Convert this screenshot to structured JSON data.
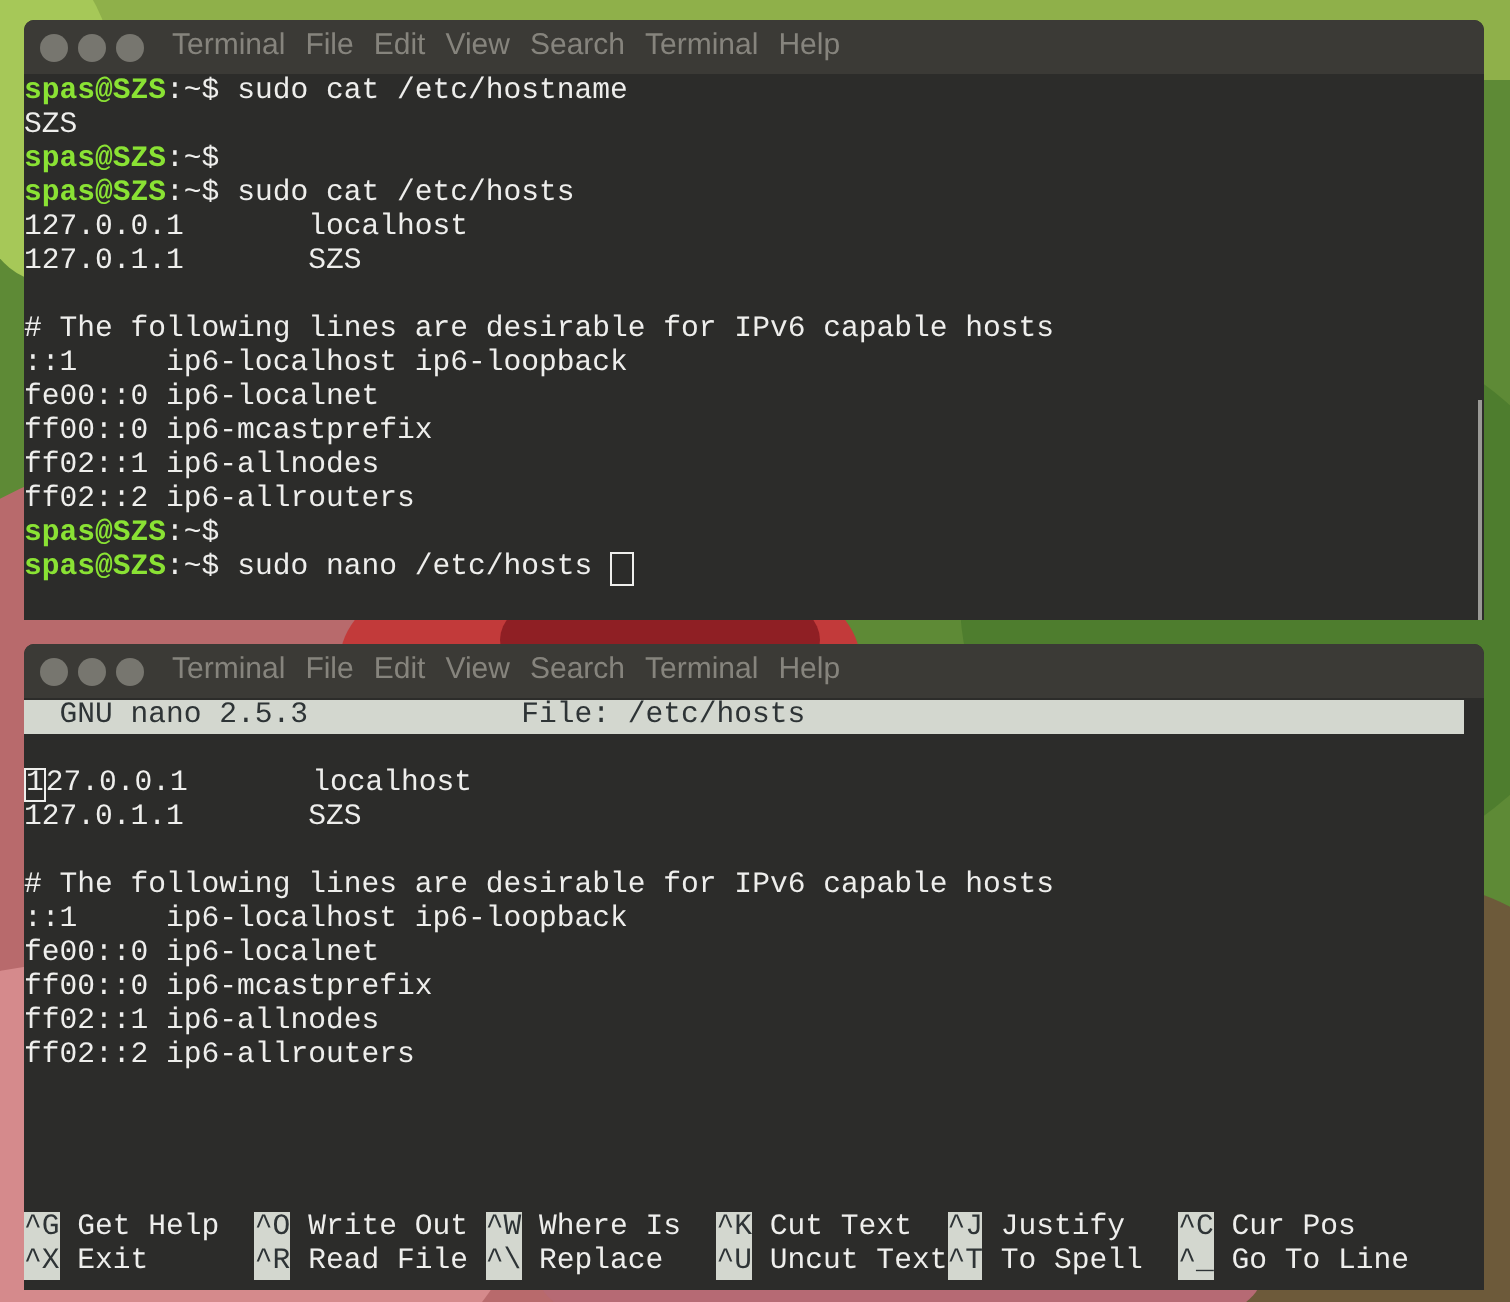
{
  "terminals": [
    {
      "kind": "shell",
      "menu": [
        "Terminal",
        "File",
        "Edit",
        "View",
        "Search",
        "Terminal",
        "Help"
      ],
      "lines": [
        {
          "kind": "prompt",
          "user": "spas@SZS",
          "path": ":~$",
          "command": "sudo cat /etc/hostname",
          "cursor": false
        },
        {
          "kind": "output",
          "text": "SZS"
        },
        {
          "kind": "prompt",
          "user": "spas@SZS",
          "path": ":~$",
          "cursor": false
        },
        {
          "kind": "prompt",
          "user": "spas@SZS",
          "path": ":~$",
          "command": "sudo cat /etc/hosts",
          "cursor": false
        },
        {
          "kind": "output",
          "text": "127.0.0.1       localhost"
        },
        {
          "kind": "output",
          "text": "127.0.1.1       SZS"
        },
        {
          "kind": "blank"
        },
        {
          "kind": "output",
          "text": "# The following lines are desirable for IPv6 capable hosts"
        },
        {
          "kind": "output",
          "text": "::1     ip6-localhost ip6-loopback"
        },
        {
          "kind": "output",
          "text": "fe00::0 ip6-localnet"
        },
        {
          "kind": "output",
          "text": "ff00::0 ip6-mcastprefix"
        },
        {
          "kind": "output",
          "text": "ff02::1 ip6-allnodes"
        },
        {
          "kind": "output",
          "text": "ff02::2 ip6-allrouters"
        },
        {
          "kind": "prompt",
          "user": "spas@SZS",
          "path": ":~$",
          "cursor": false
        },
        {
          "kind": "prompt",
          "user": "spas@SZS",
          "path": ":~$",
          "command": "sudo nano /etc/hosts",
          "cursor": true
        }
      ]
    },
    {
      "kind": "nano",
      "menu": [
        "Terminal",
        "File",
        "Edit",
        "View",
        "Search",
        "Terminal",
        "Help"
      ],
      "header": {
        "version": "GNU nano 2.5.3",
        "file": "File: /etc/hosts"
      },
      "lines": [
        {
          "kind": "blank"
        },
        {
          "kind": "cursor",
          "cursor": "1",
          "text": "27.0.0.1       localhost"
        },
        {
          "kind": "output",
          "text": "127.0.1.1       SZS"
        },
        {
          "kind": "blank"
        },
        {
          "kind": "output",
          "text": "# The following lines are desirable for IPv6 capable hosts"
        },
        {
          "kind": "output",
          "text": "::1     ip6-localhost ip6-loopback"
        },
        {
          "kind": "output",
          "text": "fe00::0 ip6-localnet"
        },
        {
          "kind": "output",
          "text": "ff00::0 ip6-mcastprefix"
        },
        {
          "kind": "output",
          "text": "ff02::1 ip6-allnodes"
        },
        {
          "kind": "output",
          "text": "ff02::2 ip6-allrouters"
        }
      ],
      "shortcuts": [
        {
          "key": "^G",
          "label": "Get Help"
        },
        {
          "key": "^O",
          "label": "Write Out"
        },
        {
          "key": "^W",
          "label": "Where Is"
        },
        {
          "key": "^K",
          "label": "Cut Text"
        },
        {
          "key": "^J",
          "label": "Justify"
        },
        {
          "key": "^C",
          "label": "Cur Pos"
        },
        {
          "key": "^X",
          "label": "Exit"
        },
        {
          "key": "^R",
          "label": "Read File"
        },
        {
          "key": "^\\",
          "label": "Replace"
        },
        {
          "key": "^U",
          "label": "Uncut Text"
        },
        {
          "key": "^T",
          "label": "To Spell"
        },
        {
          "key": "^_",
          "label": "Go To Line"
        }
      ]
    }
  ]
}
